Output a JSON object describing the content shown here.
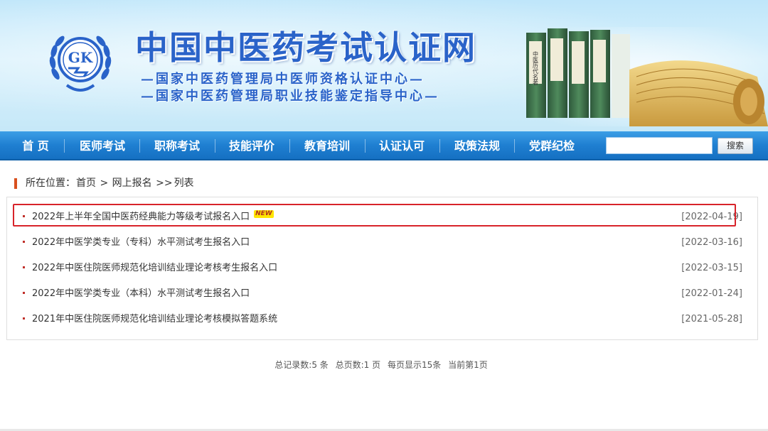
{
  "colors": {
    "brand_blue": "#2a63c9",
    "nav_blue": "#1f7fd1",
    "highlight_red": "#d8232a",
    "bullet_red": "#c0302a",
    "breadcrumb_marker": "#d9501e"
  },
  "header": {
    "logo_text": "GK",
    "site_title": "中国中医药考试认证网",
    "subtitle_1": "—国家中医药管理局中医师资格认证中心—",
    "subtitle_2": "—国家中医药管理局职业技能鉴定指导中心—",
    "book_spine_text": "中医历代名著"
  },
  "nav": {
    "items": [
      {
        "label": "首 页"
      },
      {
        "label": "医师考试"
      },
      {
        "label": "职称考试"
      },
      {
        "label": "技能评价"
      },
      {
        "label": "教育培训"
      },
      {
        "label": "认证认可"
      },
      {
        "label": "政策法规"
      },
      {
        "label": "党群纪检"
      }
    ],
    "search": {
      "value": "",
      "placeholder": "",
      "button_label": "搜索"
    }
  },
  "breadcrumb": {
    "prefix": "所在位置：",
    "home": "首页",
    "sep1": " > ",
    "section": "网上报名",
    "sep2": " >>",
    "current": "列表"
  },
  "list": {
    "new_badge": "NEW",
    "items": [
      {
        "title": "2022年上半年全国中医药经典能力等级考试报名入口",
        "date": "[2022-04-19]",
        "is_new": true
      },
      {
        "title": "2022年中医学类专业（专科）水平测试考生报名入口",
        "date": "[2022-03-16]",
        "is_new": false
      },
      {
        "title": "2022年中医住院医师规范化培训结业理论考核考生报名入口",
        "date": "[2022-03-15]",
        "is_new": false
      },
      {
        "title": "2022年中医学类专业（本科）水平测试考生报名入口",
        "date": "[2022-01-24]",
        "is_new": false
      },
      {
        "title": "2021年中医住院医师规范化培训结业理论考核模拟答题系统",
        "date": "[2021-05-28]",
        "is_new": false
      }
    ]
  },
  "pagination": {
    "total_records": "总记录数:5 条",
    "total_pages": "总页数:1 页",
    "per_page": "每页显示15条",
    "current_page": "当前第1页"
  }
}
